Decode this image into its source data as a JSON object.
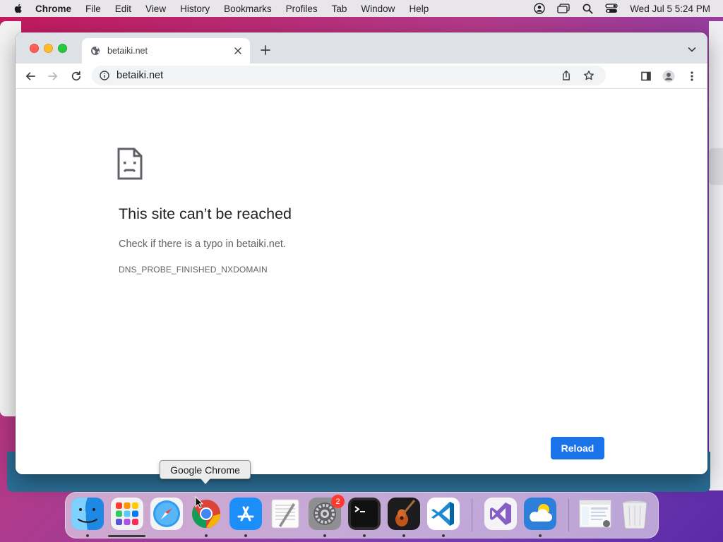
{
  "menubar": {
    "app_name": "Chrome",
    "items": [
      "File",
      "Edit",
      "View",
      "History",
      "Bookmarks",
      "Profiles",
      "Tab",
      "Window",
      "Help"
    ],
    "clock": "Wed Jul 5  5:24 PM"
  },
  "browser": {
    "tab": {
      "title": "betaiki.net"
    },
    "omnibox": {
      "url": "betaiki.net"
    }
  },
  "error_page": {
    "title": "This site can’t be reached",
    "description": "Check if there is a typo in betaiki.net.",
    "code": "DNS_PROBE_FINISHED_NXDOMAIN",
    "reload_label": "Reload"
  },
  "dock": {
    "tooltip": "Google Chrome",
    "icons": [
      "finder-icon",
      "launchpad-icon",
      "safari-icon",
      "chrome-icon",
      "app-store-icon",
      "textedit-icon",
      "system-settings-icon",
      "terminal-icon",
      "garageband-icon",
      "vscode-icon",
      "visual-studio-icon",
      "weather-icon",
      "preview-doc-icon",
      "trash-icon"
    ],
    "system_settings_badge": "2"
  },
  "colors": {
    "accent": "#1a73e8",
    "tab_strip": "#dee1e6",
    "badge": "#ff3b30"
  }
}
